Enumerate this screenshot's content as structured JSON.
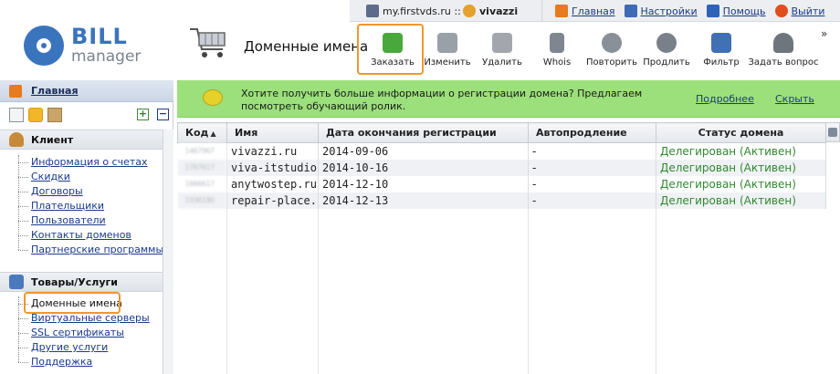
{
  "topbar": {
    "site": "my.firstvds.ru ::",
    "user": "vivazzi",
    "links": [
      {
        "label": "Главная",
        "icon": "home-icon"
      },
      {
        "label": "Настройки",
        "icon": "settings-icon"
      },
      {
        "label": "Помощь",
        "icon": "help-icon"
      },
      {
        "label": "Выйти",
        "icon": "exit-icon"
      }
    ]
  },
  "logo": {
    "top": "BILL",
    "bottom": "manager"
  },
  "page": {
    "title": "Доменные имена"
  },
  "toolbar": {
    "order": "Заказать",
    "edit": "Изменить",
    "delete": "Удалить",
    "whois": "Whois",
    "repeat": "Повторить",
    "renew": "Продлить",
    "filter": "Фильтр",
    "ask": "Задать вопрос",
    "more": "»"
  },
  "sidebar": {
    "home": "Главная",
    "client_section": "Клиент",
    "client_items": [
      "Информация о счетах",
      "Скидки",
      "Договоры",
      "Плательщики",
      "Пользователи",
      "Контакты доменов",
      "Партнерские программы"
    ],
    "goods_section": "Товары/Услуги",
    "goods_items": [
      "Доменные имена",
      "Виртуальные серверы",
      "SSL сертификаты",
      "Другие услуги",
      "Поддержка"
    ],
    "plus": "+",
    "minus": "−"
  },
  "promo": {
    "text": "Хотите получить больше информации о регистрации домена? Предлагаем посмотреть обучающий ролик.",
    "more": "Подробнее",
    "hide": "Скрыть"
  },
  "table": {
    "columns": {
      "code": "Код",
      "name": "Имя",
      "expires": "Дата окончания регистрации",
      "autorenew": "Автопродление",
      "status": "Статус домена"
    },
    "rows": [
      {
        "code": "1467967",
        "name": "vivazzi.ru",
        "expires": "2014-09-06",
        "autorenew": "-",
        "status": "Делегирован (Активен)"
      },
      {
        "code": "1787617",
        "name": "viva-itstudio.ru",
        "expires": "2014-10-16",
        "autorenew": "-",
        "status": "Делегирован (Активен)"
      },
      {
        "code": "1666617",
        "name": "anytwostep.ru",
        "expires": "2014-12-10",
        "autorenew": "-",
        "status": "Делегирован (Активен)"
      },
      {
        "code": "1936180",
        "name": "repair-place.ru",
        "expires": "2014-12-13",
        "autorenew": "-",
        "status": "Делегирован (Активен)"
      }
    ]
  },
  "colors": {
    "accent_blue": "#3a74bd",
    "highlight_orange": "#f0962f",
    "promo_green": "#9be07a",
    "status_green": "#2f8a2f",
    "link_blue": "#1a3a8a"
  }
}
